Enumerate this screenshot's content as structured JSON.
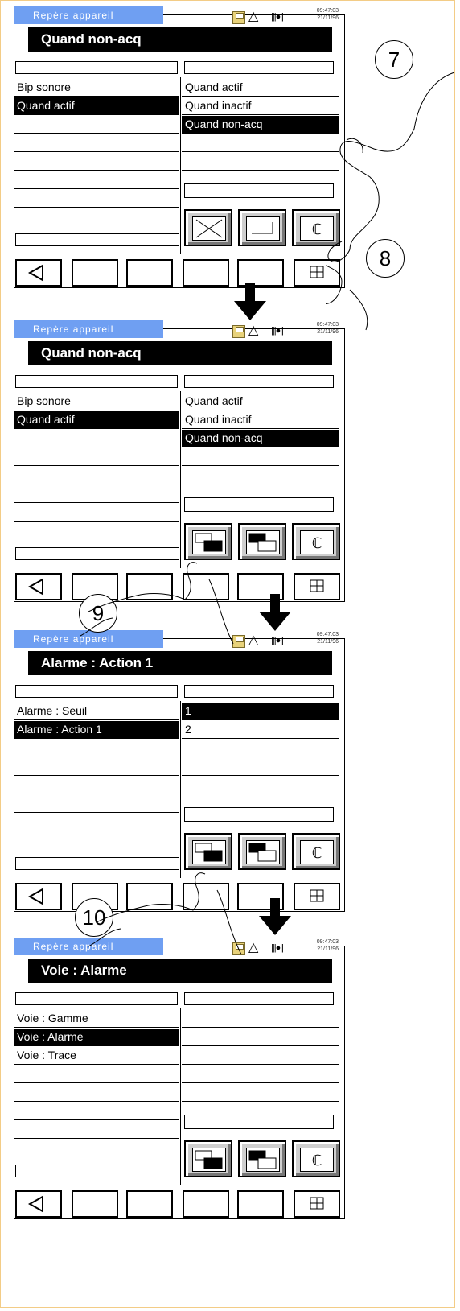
{
  "screens": [
    {
      "title": "Repère appareil",
      "clock_time": "09:47:03",
      "clock_date": "21/11/96",
      "heading": "Quand  non-acq",
      "left_items": [
        "Bip sonore",
        "Quand actif",
        "",
        "",
        "",
        "",
        ""
      ],
      "left_selected": 1,
      "right_items": [
        "Quand actif",
        "Quand inactif",
        "Quand non-acq",
        "",
        ""
      ],
      "right_selected": 2,
      "action_buttons": [
        "cancel-x-icon",
        "enter-icon",
        "help-icon"
      ],
      "softkeys": [
        "back-arrow-icon",
        "",
        "",
        "",
        "",
        "grid-icon"
      ]
    },
    {
      "title": "Repère appareil",
      "clock_time": "09:47:03",
      "clock_date": "21/11/96",
      "heading": "Quand  non-acq",
      "left_items": [
        "Bip sonore",
        "Quand actif",
        "",
        "",
        "",
        "",
        ""
      ],
      "left_selected": 1,
      "right_items": [
        "Quand actif",
        "Quand inactif",
        "Quand non-acq",
        "",
        ""
      ],
      "right_selected": 2,
      "action_buttons": [
        "move-down-icon",
        "move-up-icon",
        "help-icon"
      ],
      "softkeys": [
        "back-arrow-icon",
        "",
        "",
        "",
        "",
        "grid-icon"
      ]
    },
    {
      "title": "Repère appareil",
      "clock_time": "09:47:03",
      "clock_date": "21/11/96",
      "heading": "Alarme : Action 1",
      "left_items": [
        "Alarme : Seuil",
        "Alarme : Action 1",
        "",
        "",
        "",
        "",
        ""
      ],
      "left_selected": 1,
      "right_items": [
        "1",
        "2",
        "",
        "",
        ""
      ],
      "right_selected": 0,
      "action_buttons": [
        "move-down-icon",
        "move-up-icon",
        "help-icon"
      ],
      "softkeys": [
        "back-arrow-icon",
        "",
        "",
        "",
        "",
        "grid-icon"
      ]
    },
    {
      "title": "Repère appareil",
      "clock_time": "09:47:03",
      "clock_date": "21/11/96",
      "heading": "Voie : Alarme",
      "left_items": [
        "Voie : Gamme",
        "Voie : Alarme",
        "Voie : Trace",
        "",
        "",
        "",
        ""
      ],
      "left_selected": 1,
      "right_items": [
        "",
        "",
        "",
        "",
        ""
      ],
      "right_selected": -1,
      "action_buttons": [
        "move-down-icon",
        "move-up-icon",
        "help-icon"
      ],
      "softkeys": [
        "back-arrow-icon",
        "",
        "",
        "",
        "",
        "grid-icon"
      ]
    }
  ],
  "callouts": [
    "7",
    "8",
    "9",
    "10"
  ],
  "colors": {
    "title_bar": "#6f9ff2",
    "selection": "#000000",
    "frame": "#f3cc86"
  }
}
